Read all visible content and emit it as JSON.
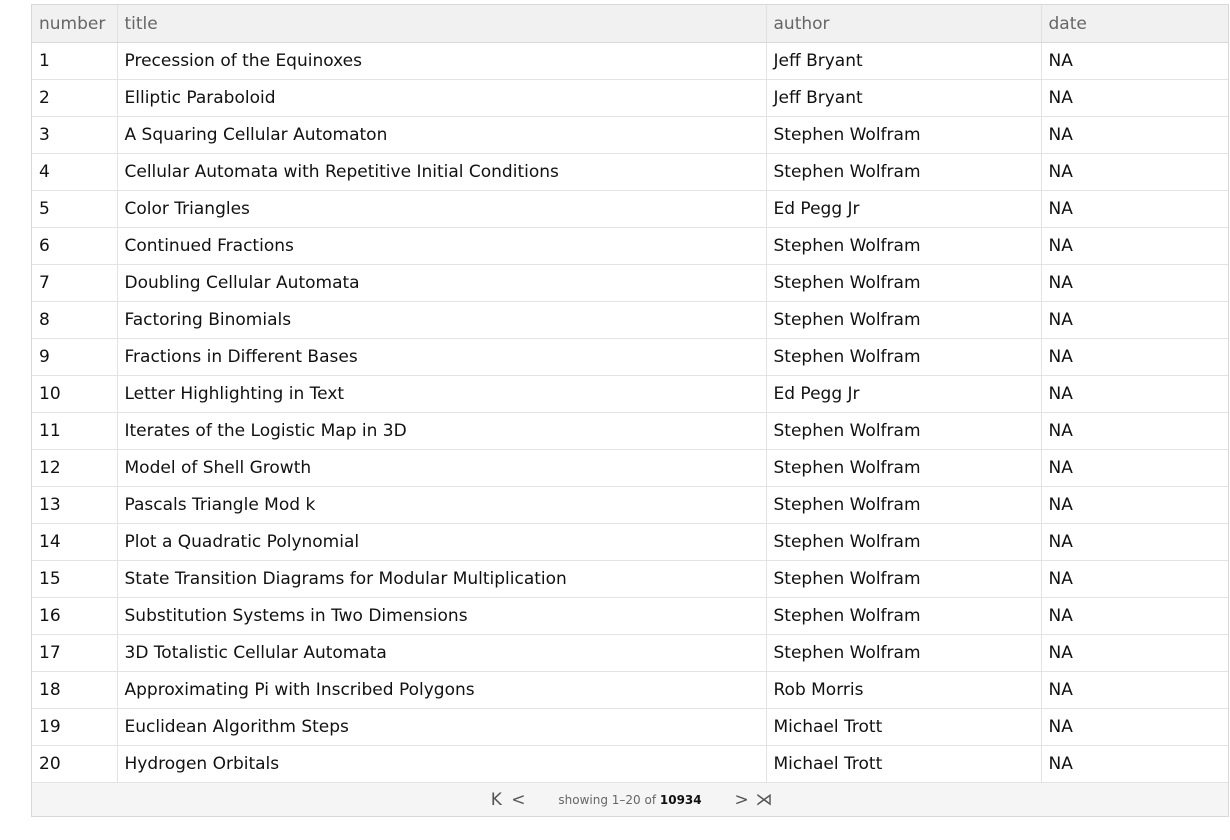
{
  "table": {
    "columns": [
      "number",
      "title",
      "author",
      "date"
    ],
    "rows": [
      [
        "1",
        "Precession of the Equinoxes",
        "Jeff Bryant",
        "NA"
      ],
      [
        "2",
        "Elliptic Paraboloid",
        "Jeff Bryant",
        "NA"
      ],
      [
        "3",
        "A Squaring Cellular Automaton",
        "Stephen Wolfram",
        "NA"
      ],
      [
        "4",
        "Cellular Automata with Repetitive Initial Conditions",
        "Stephen Wolfram",
        "NA"
      ],
      [
        "5",
        "Color Triangles",
        "Ed Pegg Jr",
        "NA"
      ],
      [
        "6",
        "Continued Fractions",
        "Stephen Wolfram",
        "NA"
      ],
      [
        "7",
        "Doubling Cellular Automata",
        "Stephen Wolfram",
        "NA"
      ],
      [
        "8",
        "Factoring Binomials",
        "Stephen Wolfram",
        "NA"
      ],
      [
        "9",
        "Fractions in Different Bases",
        "Stephen Wolfram",
        "NA"
      ],
      [
        "10",
        "Letter Highlighting in Text",
        "Ed Pegg Jr",
        "NA"
      ],
      [
        "11",
        "Iterates of the Logistic Map in 3D",
        "Stephen Wolfram",
        "NA"
      ],
      [
        "12",
        "Model of Shell Growth",
        "Stephen Wolfram",
        "NA"
      ],
      [
        "13",
        "Pascals Triangle Mod k",
        "Stephen Wolfram",
        "NA"
      ],
      [
        "14",
        "Plot a Quadratic Polynomial",
        "Stephen Wolfram",
        "NA"
      ],
      [
        "15",
        "State Transition Diagrams for Modular Multiplication",
        "Stephen Wolfram",
        "NA"
      ],
      [
        "16",
        "Substitution Systems in Two Dimensions",
        "Stephen Wolfram",
        "NA"
      ],
      [
        "17",
        "3D Totalistic Cellular Automata",
        "Stephen Wolfram",
        "NA"
      ],
      [
        "18",
        "Approximating Pi with Inscribed Polygons",
        "Rob Morris",
        "NA"
      ],
      [
        "19",
        "Euclidean Algorithm Steps",
        "Michael Trott",
        "NA"
      ],
      [
        "20",
        "Hydrogen Orbitals",
        "Michael Trott",
        "NA"
      ]
    ]
  },
  "pagination": {
    "first_glyph": "K",
    "prev_glyph": "<",
    "next_glyph": ">",
    "last_glyph": "⋊",
    "showing_prefix": "showing 1–20 of",
    "total": "10934"
  }
}
